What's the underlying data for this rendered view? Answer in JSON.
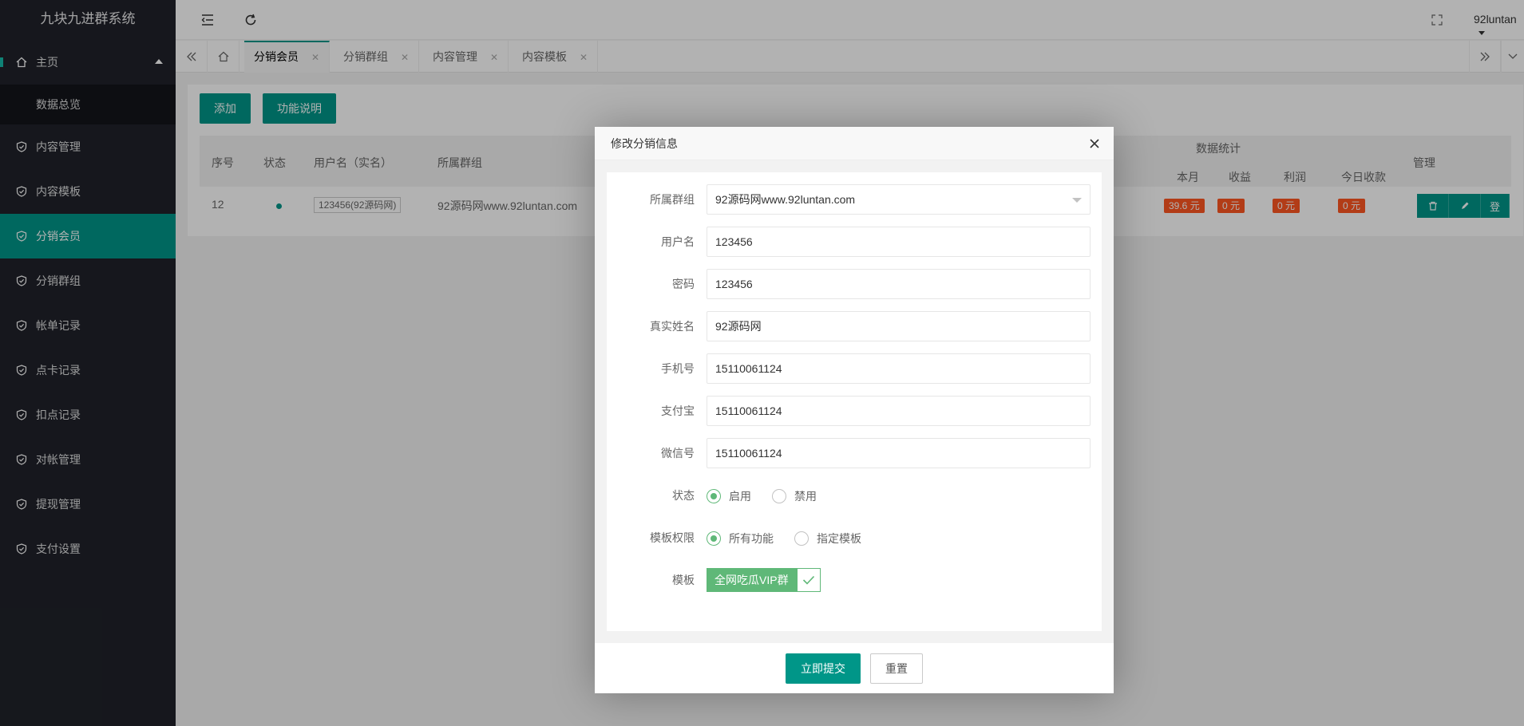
{
  "sidebar": {
    "logo": "九块九进群系统",
    "home": "主页",
    "sub_item": "数据总览",
    "items": [
      {
        "label": "内容管理"
      },
      {
        "label": "内容模板"
      },
      {
        "label": "分销会员"
      },
      {
        "label": "分销群组"
      },
      {
        "label": "帐单记录"
      },
      {
        "label": "点卡记录"
      },
      {
        "label": "扣点记录"
      },
      {
        "label": "对帐管理"
      },
      {
        "label": "提现管理"
      },
      {
        "label": "支付设置"
      }
    ],
    "active_index": 2
  },
  "header": {
    "username": "92luntan"
  },
  "tabs": [
    {
      "label": "分销会员"
    },
    {
      "label": "分销群组"
    },
    {
      "label": "内容管理"
    },
    {
      "label": "内容模板"
    }
  ],
  "toolbar": {
    "add": "添加",
    "help": "功能说明"
  },
  "table": {
    "headers": {
      "no": "序号",
      "status": "状态",
      "user": "用户名（实名）",
      "group": "所属群组",
      "stats": "数据统计",
      "month": "本月",
      "income": "收益",
      "profit": "利润",
      "today": "今日收款",
      "manage": "管理"
    },
    "row": {
      "no": "12",
      "user": "123456(92源码网)",
      "group": "92源码网www.92luntan.com",
      "month": "39.6 元",
      "income": "0 元",
      "profit": "0 元",
      "today": "0 元",
      "login": "登"
    }
  },
  "modal": {
    "title": "修改分销信息",
    "fields": {
      "group": {
        "label": "所属群组",
        "value": "92源码网www.92luntan.com"
      },
      "username": {
        "label": "用户名",
        "value": "123456"
      },
      "password": {
        "label": "密码",
        "value": "123456"
      },
      "realname": {
        "label": "真实姓名",
        "value": "92源码网"
      },
      "phone": {
        "label": "手机号",
        "value": "15110061124"
      },
      "alipay": {
        "label": "支付宝",
        "value": "15110061124"
      },
      "wechat": {
        "label": "微信号",
        "value": "15110061124"
      }
    },
    "status": {
      "label": "状态",
      "opt1": "启用",
      "opt2": "禁用"
    },
    "perm": {
      "label": "模板权限",
      "opt1": "所有功能",
      "opt2": "指定模板"
    },
    "template": {
      "label": "模板",
      "value": "全网吃瓜VIP群"
    },
    "submit": "立即提交",
    "reset": "重置"
  },
  "colors": {
    "primary": "#009688",
    "sidebar": "#20222a",
    "tag": "#ff5722",
    "check": "#5fb878"
  }
}
